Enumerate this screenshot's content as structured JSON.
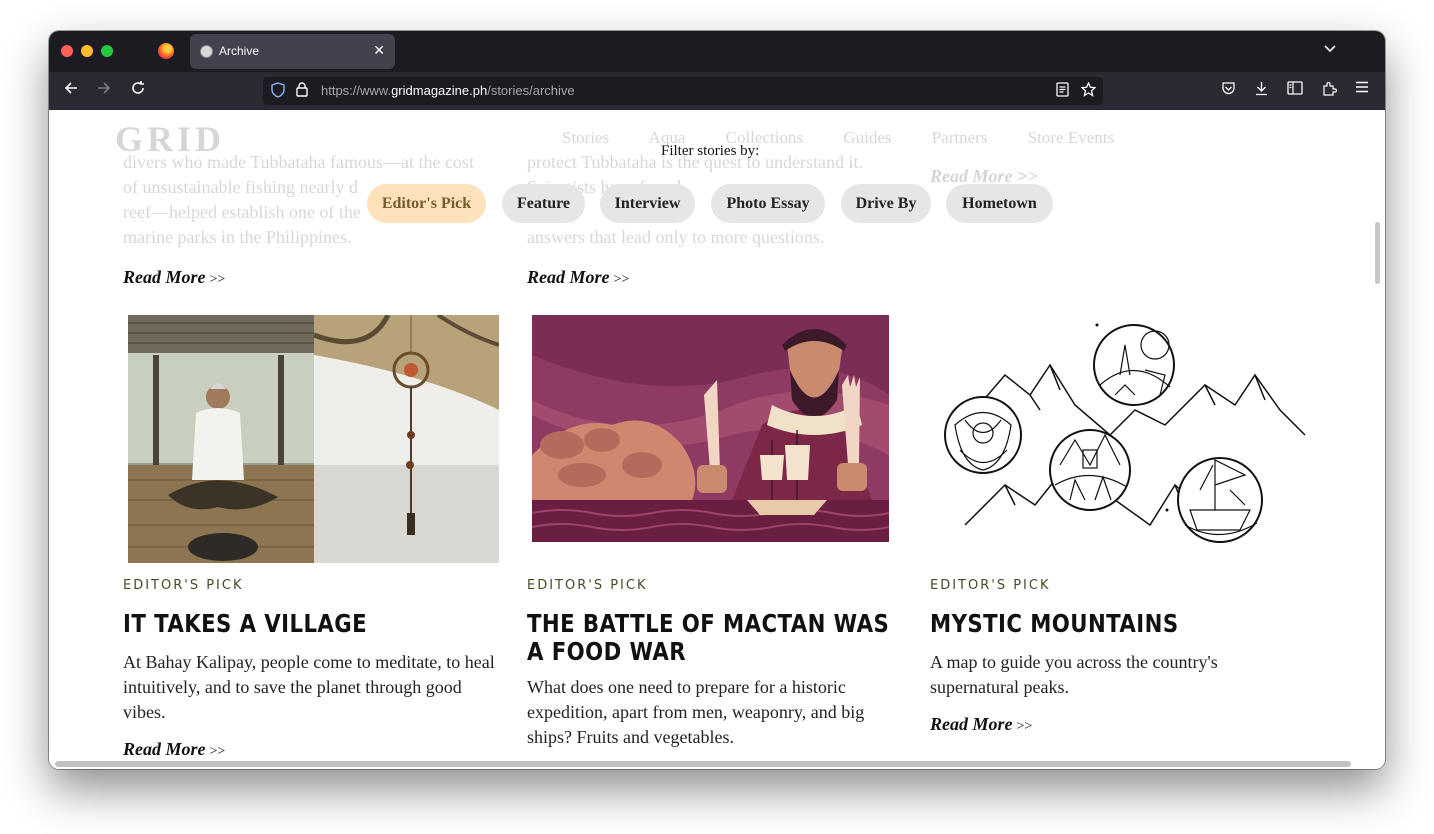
{
  "browser": {
    "tab_title": "Archive",
    "tab_close": "✕",
    "tab_list_icon": "chevron-down-icon",
    "url_prefix": "https://www.",
    "url_host": "gridmagazine.ph",
    "url_path": "/stories/archive"
  },
  "site": {
    "logo": "GRID",
    "nav": [
      "Stories",
      "Aqua",
      "Collections",
      "Guides",
      "Partners",
      "Store Events"
    ]
  },
  "filter": {
    "label": "Filter stories by:",
    "options": [
      "Editor's Pick",
      "Feature",
      "Interview",
      "Photo Essay",
      "Drive By",
      "Hometown"
    ],
    "selected": "Editor's Pick"
  },
  "previous_row": {
    "col1_text": [
      "divers who made Tubbataha famous—at the cost",
      "of unsustainable fishing nearly d",
      "reef—helped establish one of the",
      "marine parks in the Philippines."
    ],
    "col2_text": [
      "protect Tubbataha is the quest to understand it.",
      "Scientists have found",
      "answers that lead only to more questions."
    ],
    "read_more": "Read More",
    "read_more_arrow": ">>"
  },
  "cards": [
    {
      "category": "EDITOR'S PICK",
      "title": "IT TAKES A VILLAGE",
      "description": "At Bahay Kalipay, people come to meditate, to heal intuitively, and to save the planet through good vibes.",
      "read_more": "Read More",
      "read_more_arrow": ">>"
    },
    {
      "category": "EDITOR'S PICK",
      "title": "THE BATTLE OF MACTAN WAS A FOOD WAR",
      "description": "What does one need to prepare for a historic expedition, apart from men, weaponry, and big ships? Fruits and vegetables.",
      "read_more": "Read More",
      "read_more_arrow": ">>"
    },
    {
      "category": "EDITOR'S PICK",
      "title": "MYSTIC MOUNTAINS",
      "description": "A map to guide you across the country's supernatural peaks.",
      "read_more": "Read More",
      "read_more_arrow": ">>"
    }
  ],
  "colors": {
    "chip_active_bg": "#fde2bc",
    "chip_bg": "#e6e6e6",
    "category": "#4a4a26",
    "chrome_dark": "#1c1b22"
  }
}
